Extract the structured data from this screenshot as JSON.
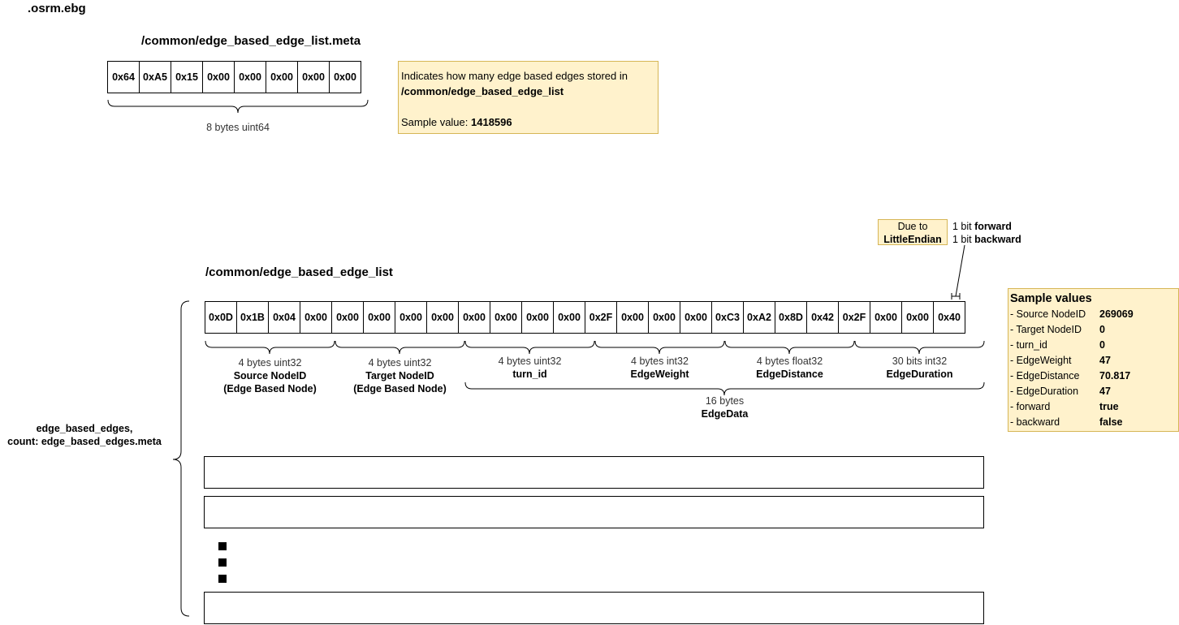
{
  "file_title": ".osrm.ebg",
  "meta_section": {
    "title": "/common/edge_based_edge_list.meta",
    "bytes": [
      "0x64",
      "0xA5",
      "0x15",
      "0x00",
      "0x00",
      "0x00",
      "0x00",
      "0x00"
    ],
    "brace_label": "8 bytes uint64",
    "note": {
      "line1": "Indicates how many edge based edges stored in",
      "line2": "/common/edge_based_edge_list",
      "sample_prefix": "Sample value: ",
      "sample_value": "1418596"
    }
  },
  "list_section": {
    "title": "/common/edge_based_edge_list",
    "bytes": [
      "0x0D",
      "0x1B",
      "0x04",
      "0x00",
      "0x00",
      "0x00",
      "0x00",
      "0x00",
      "0x00",
      "0x00",
      "0x00",
      "0x00",
      "0x2F",
      "0x00",
      "0x00",
      "0x00",
      "0xC3",
      "0xA2",
      "0x8D",
      "0x42",
      "0x2F",
      "0x00",
      "0x00",
      "0x40"
    ],
    "fields": [
      {
        "type": "4 bytes uint32",
        "name": "Source NodeID",
        "sub": "(Edge Based Node)"
      },
      {
        "type": "4 bytes uint32",
        "name": "Target NodeID",
        "sub": "(Edge Based Node)"
      },
      {
        "type": "4 bytes uint32",
        "name": "turn_id",
        "sub": ""
      },
      {
        "type": "4 bytes int32",
        "name": "EdgeWeight",
        "sub": ""
      },
      {
        "type": "4 bytes float32",
        "name": "EdgeDistance",
        "sub": ""
      },
      {
        "type": "30 bits int32",
        "name": "EdgeDuration",
        "sub": ""
      }
    ],
    "edgedata_label": "16 bytes",
    "edgedata_name": "EdgeData",
    "endian_note": {
      "line1": "Due to",
      "line2": "LittleEndian"
    },
    "bits_note": {
      "forward_prefix": "1 bit ",
      "forward_name": "forward",
      "backward_prefix": "1 bit ",
      "backward_name": "backward"
    },
    "side_label": {
      "line1": "edge_based_edges,",
      "line2": "count: edge_based_edges.meta"
    }
  },
  "sample_values": {
    "title": "Sample values",
    "rows": [
      {
        "key": "- Source NodeID",
        "value": "269069"
      },
      {
        "key": "- Target NodeID",
        "value": "0"
      },
      {
        "key": "- turn_id",
        "value": "0"
      },
      {
        "key": "- EdgeWeight",
        "value": "47"
      },
      {
        "key": "- EdgeDistance",
        "value": "70.817"
      },
      {
        "key": "- EdgeDuration",
        "value": "47"
      },
      {
        "key": "- forward",
        "value": "true"
      },
      {
        "key": "- backward",
        "value": "false"
      }
    ]
  },
  "colors": {
    "note_fill": "#fff2cc",
    "note_border": "#d6b656",
    "line": "#000000"
  }
}
